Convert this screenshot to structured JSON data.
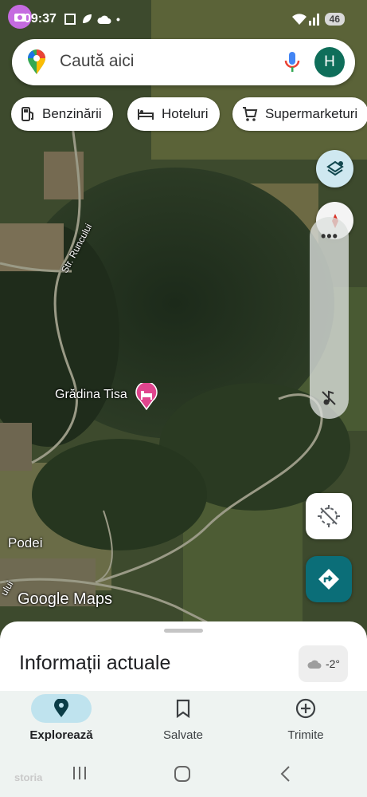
{
  "status_bar": {
    "time": "09:37",
    "battery": "46"
  },
  "search": {
    "placeholder": "Caută aici",
    "avatar_letter": "H"
  },
  "chips": [
    {
      "label": "Benzinării",
      "icon": "gas-station-icon"
    },
    {
      "label": "Hoteluri",
      "icon": "hotel-bed-icon"
    },
    {
      "label": "Supermarketuri",
      "icon": "shopping-cart-icon"
    }
  ],
  "map": {
    "place_label": "Grădina Tisa",
    "village_label": "Podei",
    "street_label": "Str. Runcului",
    "edge_label": "ului",
    "brand_label": "Google Maps"
  },
  "sheet": {
    "title": "Informații actuale",
    "weather": "-2°"
  },
  "nav": {
    "explore": "Explorează",
    "saved": "Salvate",
    "contribute": "Trimite"
  },
  "system": {
    "watermark": "storia"
  },
  "colors": {
    "accent": "#0b6e78",
    "avatar": "#0f6e5a",
    "pin_pink": "#e0458e"
  }
}
